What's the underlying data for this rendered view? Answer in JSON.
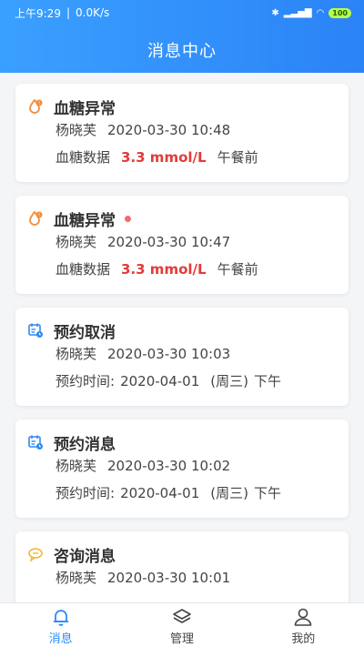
{
  "status": {
    "time": "上午9:29",
    "net_speed": "0.0K/s",
    "battery": "100"
  },
  "header": {
    "title": "消息中心"
  },
  "messages": [
    {
      "type": "blood-sugar",
      "title": "血糖异常",
      "unread": false,
      "user": "杨晓芙",
      "datetime": "2020-03-30 10:48",
      "detail_label": "血糖数据",
      "detail_value": "3.3 mmol/L",
      "detail_suffix": "午餐前"
    },
    {
      "type": "blood-sugar",
      "title": "血糖异常",
      "unread": true,
      "user": "杨晓芙",
      "datetime": "2020-03-30 10:47",
      "detail_label": "血糖数据",
      "detail_value": "3.3 mmol/L",
      "detail_suffix": "午餐前"
    },
    {
      "type": "appointment",
      "title": "预约取消",
      "user": "杨晓芙",
      "datetime": "2020-03-30 10:03",
      "detail_label": "预约时间:",
      "detail_date": "2020-04-01",
      "detail_week": "(周三)",
      "detail_period": "下午"
    },
    {
      "type": "appointment",
      "title": "预约消息",
      "user": "杨晓芙",
      "datetime": "2020-03-30 10:02",
      "detail_label": "预约时间:",
      "detail_date": "2020-04-01",
      "detail_week": "(周三)",
      "detail_period": "下午"
    },
    {
      "type": "consult",
      "title": "咨询消息",
      "user": "杨晓芙",
      "datetime": "2020-03-30 10:01"
    }
  ],
  "tabbar": {
    "items": [
      {
        "label": "消息",
        "icon": "bell-icon",
        "active": true
      },
      {
        "label": "管理",
        "icon": "layers-icon",
        "active": false
      },
      {
        "label": "我的",
        "icon": "person-icon",
        "active": false
      }
    ]
  },
  "colors": {
    "header_start": "#3aa0ff",
    "header_end": "#2b83f6",
    "alert_orange": "#f28c3a",
    "value_red": "#e43a3a",
    "appointment_blue": "#2b8af7",
    "consult_yellow": "#f3b82d",
    "tab_active": "#2b8af7"
  }
}
